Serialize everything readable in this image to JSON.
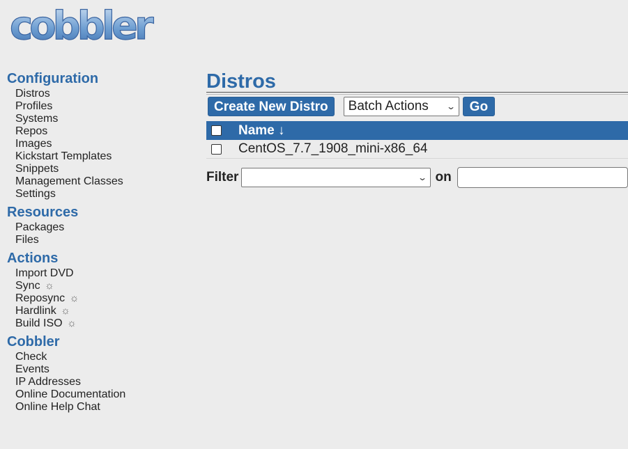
{
  "logo": {
    "text": "cobbler"
  },
  "sidebar": {
    "sections": [
      {
        "heading": "Configuration",
        "items": [
          "Distros",
          "Profiles",
          "Systems",
          "Repos",
          "Images",
          "Kickstart Templates",
          "Snippets",
          "Management Classes",
          "Settings"
        ]
      },
      {
        "heading": "Resources",
        "items": [
          "Packages",
          "Files"
        ]
      },
      {
        "heading": "Actions",
        "items": [
          "Import DVD",
          "Sync",
          "Reposync",
          "Hardlink",
          "Build ISO"
        ]
      },
      {
        "heading": "Cobbler",
        "items": [
          "Check",
          "Events",
          "IP Addresses",
          "Online Documentation",
          "Online Help Chat"
        ]
      }
    ],
    "gear_glyph": "☼"
  },
  "main": {
    "title": "Distros",
    "create_button": "Create New Distro",
    "batch_select": "Batch Actions",
    "go_button": "Go",
    "table": {
      "columns": [
        "Name ↓"
      ],
      "rows": [
        {
          "name": "CentOS_7.7_1908_mini-x86_64"
        }
      ]
    },
    "filter": {
      "label": "Filter",
      "on_label": "on",
      "select_value": "",
      "input_value": ""
    }
  },
  "colors": {
    "accent": "#2e6aa8",
    "background": "#ececec"
  }
}
